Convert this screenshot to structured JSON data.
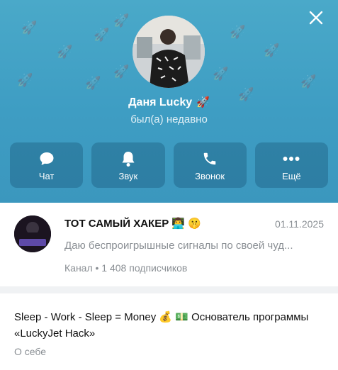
{
  "profile": {
    "name": "Даня Lucky",
    "status": "был(а) недавно"
  },
  "actions": [
    {
      "label": "Чат",
      "icon": "chat-icon"
    },
    {
      "label": "Звук",
      "icon": "bell-icon"
    },
    {
      "label": "Звонок",
      "icon": "phone-icon"
    },
    {
      "label": "Ещё",
      "icon": "more-icon"
    }
  ],
  "channel": {
    "title": "ТОТ САМЫЙ ХАКЕР 👨‍💻 🤫",
    "date": "01.11.2025",
    "description": "Даю беспроигрышные сигналы по своей чуд...",
    "subtitle": "Канал • 1 408 подписчиков",
    "avatar_text": "ТОТ САМЫЙ ХАКЕР"
  },
  "about": {
    "text": "Sleep - Work - Sleep = Money 💰 💵 Основатель программы «LuckyJet Hack»",
    "label": "О себе"
  },
  "colors": {
    "header": "#3e9dc3",
    "action_bg": "rgba(10,60,95,0.28)",
    "muted": "#8a8f94"
  }
}
